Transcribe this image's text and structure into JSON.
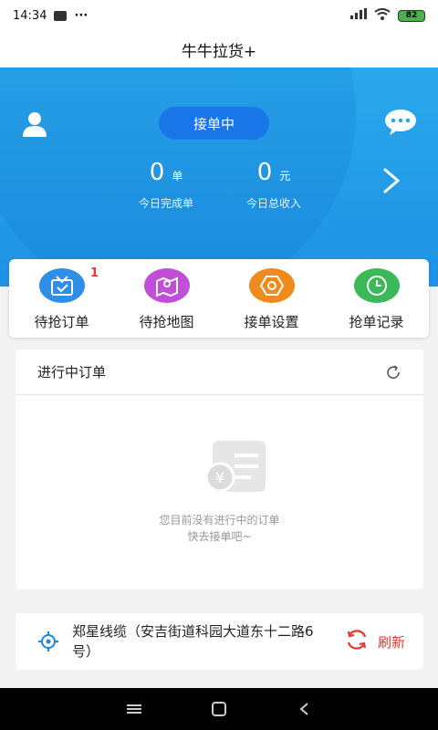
{
  "status_bar": {
    "time": "14:34",
    "notification": "···",
    "battery": "82"
  },
  "app": {
    "title": "牛牛拉货+"
  },
  "hero": {
    "status_button": "接单中",
    "completed_count": "0",
    "completed_unit": "单",
    "completed_label": "今日完成单",
    "income_amount": "0",
    "income_unit": "元",
    "income_label": "今日总收入"
  },
  "quick_actions": [
    {
      "label": "待抢订单",
      "icon": "order-box-icon",
      "color": "#2f8fe8",
      "badge": "1"
    },
    {
      "label": "待抢地图",
      "icon": "map-pin-icon",
      "color": "#c04ed8"
    },
    {
      "label": "接单设置",
      "icon": "settings-hex-icon",
      "color": "#f08a1c"
    },
    {
      "label": "抢单记录",
      "icon": "clock-icon",
      "color": "#3cb85a"
    }
  ],
  "orders": {
    "title": "进行中订单",
    "empty_line1": "您目前没有进行中的订单",
    "empty_line2": "快去接单吧~"
  },
  "location": {
    "address": "郑星线缆（安吉街道科园大道东十二路6号）",
    "refresh_label": "刷新"
  }
}
